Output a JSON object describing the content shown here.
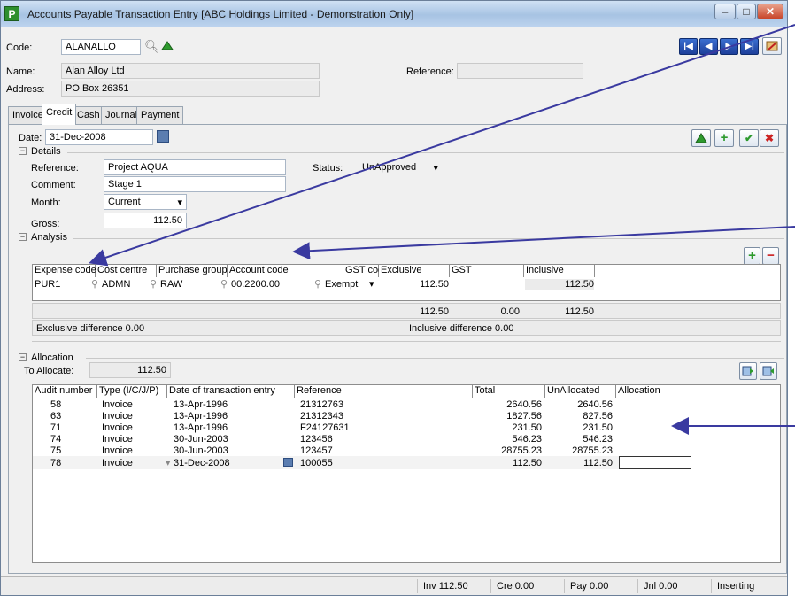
{
  "window": {
    "title": "Accounts Payable Transaction Entry [ABC Holdings Limited - Demonstration Only]",
    "app_icon_letter": "P",
    "minimize": "–",
    "maximize": "□",
    "close": "✕"
  },
  "header": {
    "code_label": "Code:",
    "code_value": "ALANALLO",
    "name_label": "Name:",
    "name_value": "Alan Alloy Ltd",
    "reference_label": "Reference:",
    "reference_value": "",
    "address_label": "Address:",
    "address_value": "PO Box 26351"
  },
  "nav": {
    "first": "|◀",
    "prev": "◀",
    "next": "▶",
    "last": "▶|"
  },
  "tabs": [
    {
      "label": "Invoice"
    },
    {
      "label": "Credit"
    },
    {
      "label": "Cash"
    },
    {
      "label": "Journal"
    },
    {
      "label": "Payment"
    }
  ],
  "form": {
    "date_label": "Date:",
    "date_value": "31-Dec-2008",
    "details_label": "Details",
    "reference_label": "Reference:",
    "reference_value": "Project AQUA",
    "comment_label": "Comment:",
    "comment_value": "Stage 1",
    "month_label": "Month:",
    "month_value": "Current",
    "gross_label": "Gross:",
    "gross_value": "112.50",
    "status_label": "Status:",
    "status_value": "UnApproved",
    "analysis_label": "Analysis"
  },
  "analysis": {
    "columns": [
      "Expense code",
      "Cost centre",
      "Purchase group",
      "Account code",
      "GST code",
      "Exclusive",
      "GST",
      "Inclusive"
    ],
    "row": {
      "expense_code": "PUR1",
      "cost_centre": "ADMN",
      "purchase_group": "RAW",
      "account_code": "00.2200.00",
      "gst_code": "Exempt",
      "exclusive": "112.50",
      "gst": "",
      "inclusive": "112.50"
    },
    "totals": {
      "exclusive": "112.50",
      "gst": "0.00",
      "inclusive": "112.50"
    },
    "exclusive_difference": "Exclusive difference 0.00",
    "inclusive_difference": "Inclusive difference 0.00"
  },
  "allocation": {
    "section_label": "Allocation",
    "to_allocate_label": "To Allocate:",
    "to_allocate_value": "112.50",
    "columns": [
      "Audit number",
      "Type (I/C/J/P)",
      "Date of transaction entry",
      "Reference",
      "Total",
      "UnAllocated",
      "Allocation"
    ],
    "rows": [
      {
        "audit": "58",
        "type": "Invoice",
        "date": "13-Apr-1996",
        "reference": "21312763",
        "total": "2640.56",
        "unallocated": "2640.56",
        "allocation": ""
      },
      {
        "audit": "63",
        "type": "Invoice",
        "date": "13-Apr-1996",
        "reference": "21312343",
        "total": "1827.56",
        "unallocated": "827.56",
        "allocation": ""
      },
      {
        "audit": "71",
        "type": "Invoice",
        "date": "13-Apr-1996",
        "reference": "F24127631",
        "total": "231.50",
        "unallocated": "231.50",
        "allocation": ""
      },
      {
        "audit": "74",
        "type": "Invoice",
        "date": "30-Jun-2003",
        "reference": "123456",
        "total": "546.23",
        "unallocated": "546.23",
        "allocation": ""
      },
      {
        "audit": "75",
        "type": "Invoice",
        "date": "30-Jun-2003",
        "reference": "123457",
        "total": "28755.23",
        "unallocated": "28755.23",
        "allocation": ""
      },
      {
        "audit": "78",
        "type": "Invoice",
        "date": "31-Dec-2008",
        "reference": "100055",
        "total": "112.50",
        "unallocated": "112.50",
        "allocation": ""
      }
    ]
  },
  "statusbar": {
    "inv": "Inv 112.50",
    "cre": "Cre 0.00",
    "pay": "Pay 0.00",
    "jnl": "Jnl 0.00",
    "mode": "Inserting"
  },
  "colors": {
    "annotation_arrow": "#3a3aa0",
    "nav_button": "#1d3f9a",
    "add_icon": "#2d9a2d",
    "delete_icon": "#cc2222"
  }
}
